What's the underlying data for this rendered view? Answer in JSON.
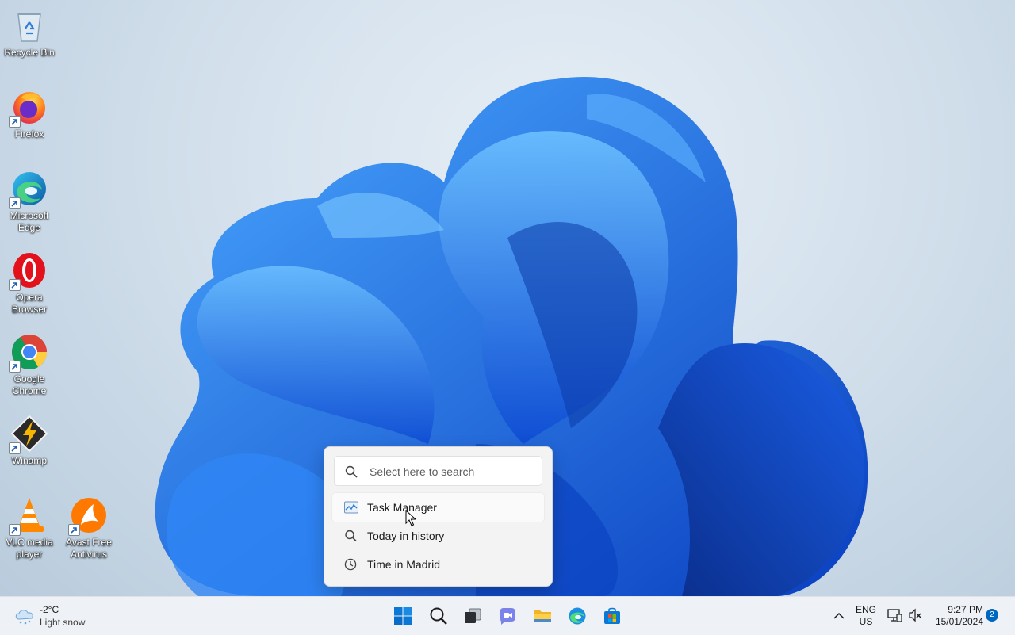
{
  "desktop": {
    "icons": [
      {
        "name": "recycle-bin",
        "label": "Recycle Bin"
      },
      {
        "name": "firefox",
        "label": "Firefox"
      },
      {
        "name": "microsoft-edge",
        "label": "Microsoft Edge"
      },
      {
        "name": "opera-browser",
        "label": "Opera Browser"
      },
      {
        "name": "google-chrome",
        "label": "Google Chrome"
      },
      {
        "name": "winamp",
        "label": "Winamp"
      },
      {
        "name": "vlc-media-player",
        "label": "VLC media player"
      },
      {
        "name": "avast-free-antivirus",
        "label": "Avast Free Antivirus"
      }
    ]
  },
  "search_popup": {
    "placeholder": "Select here to search",
    "results": [
      {
        "label": "Task Manager",
        "icon": "task-manager-icon",
        "hovered": true
      },
      {
        "label": "Today in history",
        "icon": "search-icon",
        "hovered": false
      },
      {
        "label": "Time in Madrid",
        "icon": "clock-icon",
        "hovered": false
      }
    ]
  },
  "taskbar": {
    "weather": {
      "temp": "-2°C",
      "condition": "Light snow",
      "icon": "snow-cloud-icon"
    },
    "apps": [
      {
        "name": "start",
        "icon": "windows-logo-icon"
      },
      {
        "name": "search",
        "icon": "search-icon"
      },
      {
        "name": "task-view",
        "icon": "task-view-icon"
      },
      {
        "name": "chat",
        "icon": "teams-chat-icon"
      },
      {
        "name": "file-explorer",
        "icon": "folder-icon"
      },
      {
        "name": "edge",
        "icon": "edge-icon"
      },
      {
        "name": "store",
        "icon": "store-icon"
      }
    ],
    "tray": {
      "lang_line1": "ENG",
      "lang_line2": "US",
      "time": "9:27 PM",
      "date": "15/01/2024",
      "notification_count": "2"
    }
  },
  "colors": {
    "accent": "#0067c0",
    "wallpaper_bloom": "#1a6cf0"
  }
}
